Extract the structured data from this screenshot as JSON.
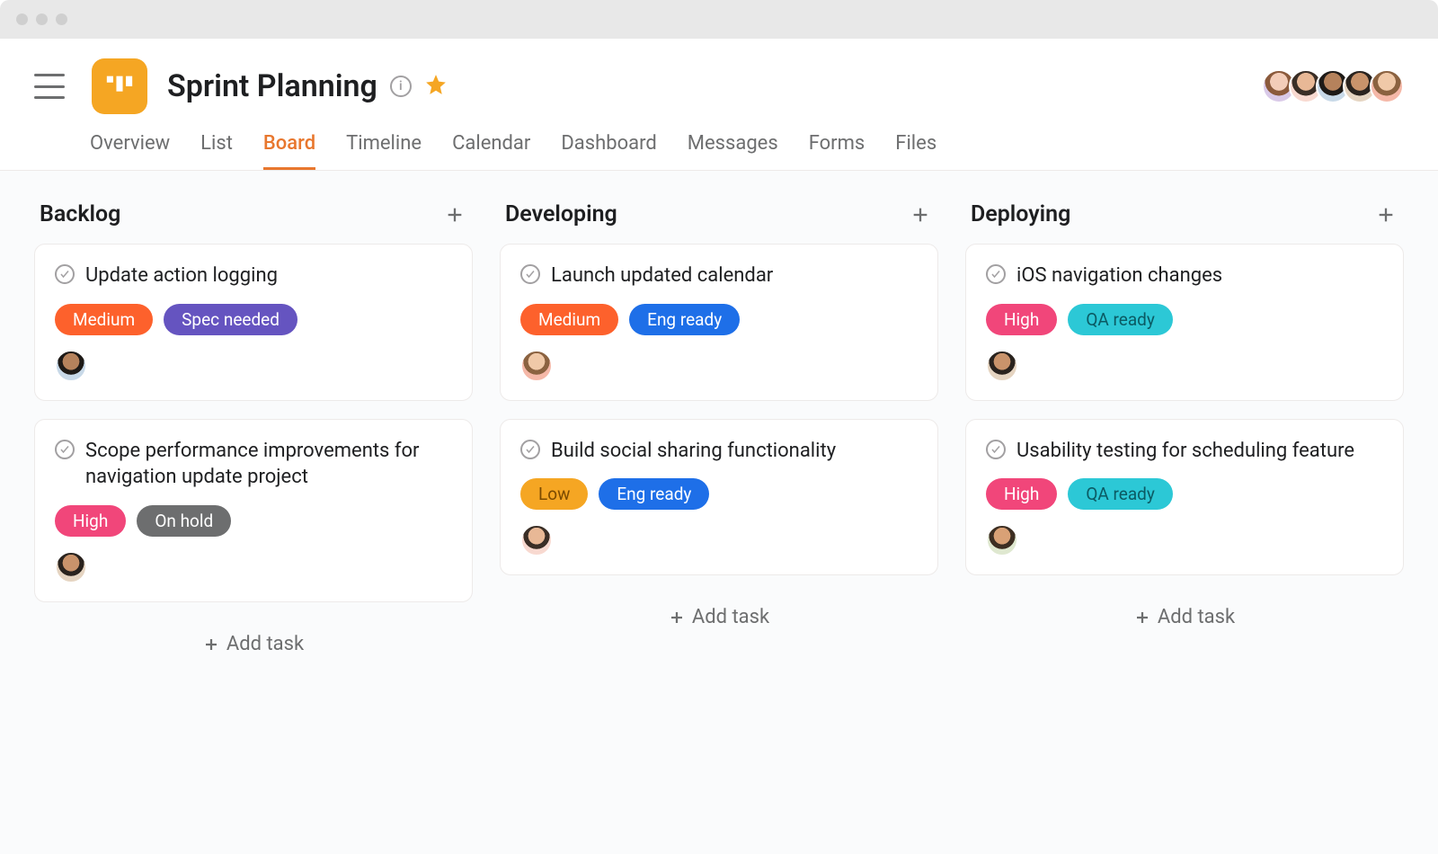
{
  "project": {
    "title": "Sprint Planning",
    "starred": true
  },
  "tabs": [
    {
      "label": "Overview",
      "active": false
    },
    {
      "label": "List",
      "active": false
    },
    {
      "label": "Board",
      "active": true
    },
    {
      "label": "Timeline",
      "active": false
    },
    {
      "label": "Calendar",
      "active": false
    },
    {
      "label": "Dashboard",
      "active": false
    },
    {
      "label": "Messages",
      "active": false
    },
    {
      "label": "Forms",
      "active": false
    },
    {
      "label": "Files",
      "active": false
    }
  ],
  "header_avatars": [
    "av1",
    "av2",
    "av3",
    "av4",
    "av5"
  ],
  "add_task_label": "Add task",
  "tag_colors": {
    "Medium": "#fd612c",
    "Spec needed": "#6554c0",
    "High": "#f1467a",
    "On hold": "#6d6e6f",
    "Eng ready": "#1e6fe8",
    "Low": "#f5a623",
    "QA ready": "#2cc8d6"
  },
  "columns": [
    {
      "title": "Backlog",
      "cards": [
        {
          "title": "Update action logging",
          "tags": [
            "Medium",
            "Spec needed"
          ],
          "assignee": "av3"
        },
        {
          "title": "Scope performance improvements for navigation update project",
          "tags": [
            "High",
            "On hold"
          ],
          "assignee": "av4"
        }
      ]
    },
    {
      "title": "Developing",
      "cards": [
        {
          "title": "Launch updated calendar",
          "tags": [
            "Medium",
            "Eng ready"
          ],
          "assignee": "av5"
        },
        {
          "title": "Build social sharing functionality",
          "tags": [
            "Low",
            "Eng ready"
          ],
          "assignee": "av2"
        }
      ]
    },
    {
      "title": "Deploying",
      "cards": [
        {
          "title": "iOS navigation changes",
          "tags": [
            "High",
            "QA ready"
          ],
          "assignee": "av4"
        },
        {
          "title": "Usability testing for scheduling feature",
          "tags": [
            "High",
            "QA ready"
          ],
          "assignee": "av6"
        }
      ]
    }
  ]
}
